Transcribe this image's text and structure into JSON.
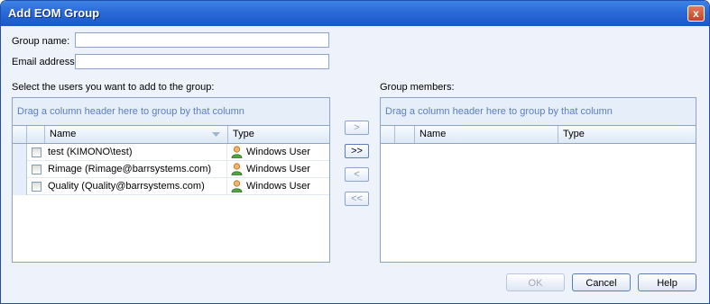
{
  "window": {
    "title": "Add EOM Group",
    "close_glyph": "x"
  },
  "form": {
    "group_name_label": "Group name:",
    "group_name_value": "",
    "email_label": "Email address:",
    "email_value": ""
  },
  "left_panel": {
    "heading": "Select the users you want to add to the group:",
    "group_hint": "Drag a column header here to group by that column",
    "columns": [
      "Name",
      "Type"
    ],
    "rows": [
      {
        "checked": false,
        "name": "test (KIMONO\\test)",
        "type": "Windows User",
        "icon": "user-icon"
      },
      {
        "checked": false,
        "name": "Rimage (Rimage@barrsystems.com)",
        "type": "Windows User",
        "icon": "user-icon"
      },
      {
        "checked": false,
        "name": "Quality (Quality@barrsystems.com)",
        "type": "Windows User",
        "icon": "user-icon"
      }
    ]
  },
  "right_panel": {
    "heading": "Group members:",
    "group_hint": "Drag a column header here to group by that column",
    "columns": [
      "Name",
      "Type"
    ],
    "rows": []
  },
  "transfer_buttons": [
    ">",
    ">>",
    "<",
    "<<"
  ],
  "footer": {
    "ok": "OK",
    "cancel": "Cancel",
    "help": "Help"
  }
}
